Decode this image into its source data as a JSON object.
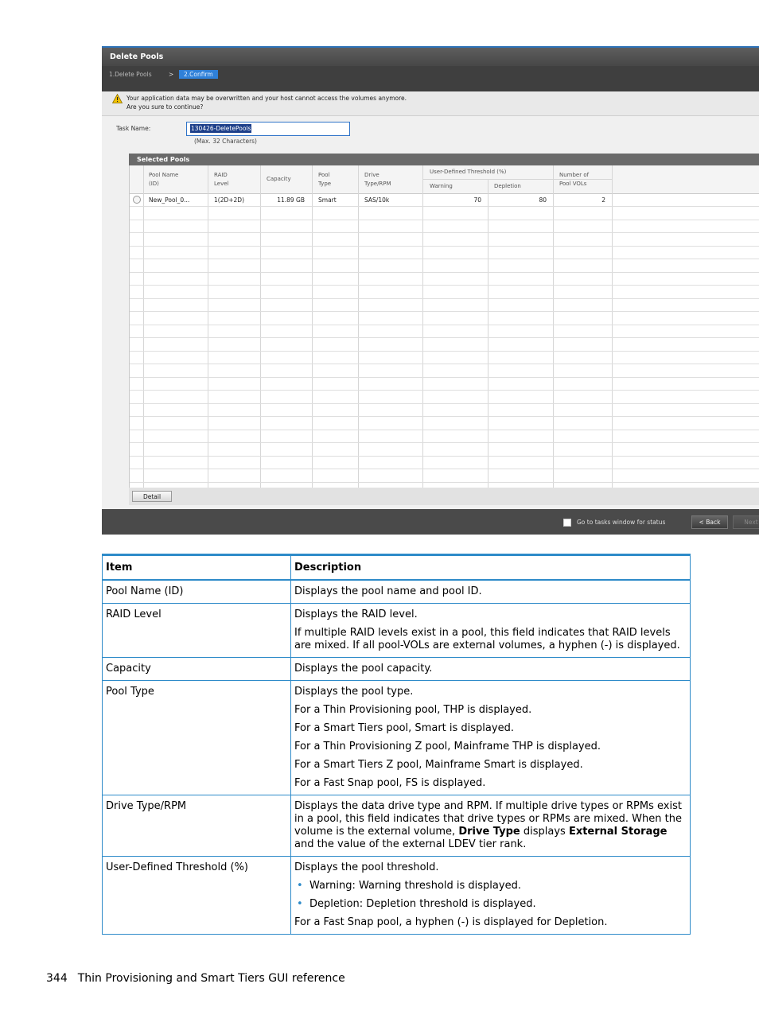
{
  "screenshot": {
    "title": "Delete Pools",
    "steps": [
      "1.Delete Pools",
      ">",
      "2.Confirm"
    ],
    "warning_lines": [
      "Your application data may be overwritten and your host cannot access the volumes anymore.",
      "Are you sure to continue?"
    ],
    "task_label": "Task Name:",
    "task_value": "130426-DeletePools",
    "task_hint": "(Max. 32 Characters)",
    "grid_title": "Selected Pools",
    "columns": {
      "pool_name": [
        "Pool Name",
        "(ID)"
      ],
      "raid": [
        "RAID",
        "Level"
      ],
      "capacity": "Capacity",
      "pool_type": [
        "Pool",
        "Type"
      ],
      "drive": [
        "Drive",
        "Type/RPM"
      ],
      "threshold": "User-Defined Threshold (%)",
      "warning": "Warning",
      "depletion": "Depletion",
      "num_vols": [
        "Number of",
        "Pool VOLs"
      ]
    },
    "row": {
      "pool_name": "New_Pool_0...",
      "raid": "1(2D+2D)",
      "capacity": "11.89 GB",
      "pool_type": "Smart",
      "drive": "SAS/10k",
      "warning": "70",
      "depletion": "80",
      "num_vols": "2"
    },
    "detail_button": "Detail",
    "checkbox_label": "Go to tasks window for status",
    "back_button": "< Back",
    "next_button": "Next"
  },
  "table": {
    "headers": [
      "Item",
      "Description"
    ],
    "rows": {
      "pool_name": {
        "item": "Pool Name (ID)",
        "p1": "Displays the pool name and pool ID."
      },
      "raid": {
        "item": "RAID Level",
        "p1": "Displays the RAID level.",
        "p2": "If multiple RAID levels exist in a pool, this field indicates that RAID levels are mixed. If all pool-VOLs are external volumes, a hyphen (-) is displayed."
      },
      "capacity": {
        "item": "Capacity",
        "p1": "Displays the pool capacity."
      },
      "pool_type": {
        "item": "Pool Type",
        "p1": "Displays the pool type.",
        "p2": "For a Thin Provisioning pool, THP is displayed.",
        "p3": "For a Smart Tiers pool, Smart is displayed.",
        "p4": "For a Thin Provisioning Z pool, Mainframe THP is displayed.",
        "p5": "For a Smart Tiers Z pool, Mainframe Smart is displayed.",
        "p6": "For a Fast Snap pool, FS is displayed."
      },
      "drive": {
        "item": "Drive Type/RPM",
        "t1": "Displays the data drive type and RPM. If multiple drive types or RPMs exist in a pool, this field indicates that drive types or RPMs are mixed. When the volume is the external volume, ",
        "b1": "Drive Type",
        "t2": " displays ",
        "b2": "External Storage",
        "t3": " and the value of the external LDEV tier rank."
      },
      "threshold": {
        "item": "User-Defined Threshold (%)",
        "p1": "Displays the pool threshold.",
        "bullets": [
          "Warning: Warning threshold is displayed.",
          "Depletion: Depletion threshold is displayed."
        ],
        "p2": "For a Fast Snap pool, a hyphen (-) is displayed for Depletion."
      }
    }
  },
  "footer": {
    "page_number": "344",
    "section": "Thin Provisioning and Smart Tiers GUI reference"
  }
}
